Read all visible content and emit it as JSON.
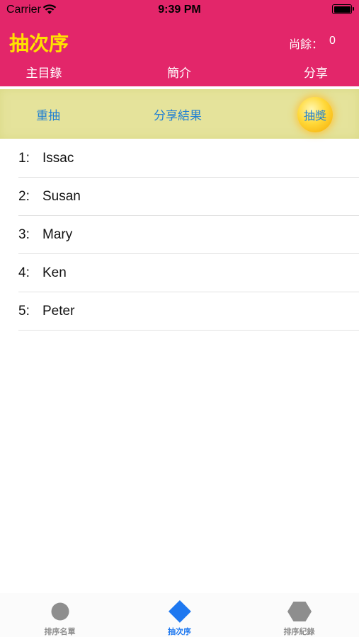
{
  "status_bar": {
    "carrier": "Carrier",
    "time": "9:39 PM"
  },
  "header": {
    "title": "抽次序",
    "remaining_label": "尚餘：",
    "remaining_value": "0",
    "nav": {
      "main_menu": "主目錄",
      "intro": "簡介",
      "share": "分享"
    }
  },
  "actions": {
    "redraw": "重抽",
    "share_result": "分享結果",
    "lottery": "抽獎"
  },
  "list": [
    {
      "num": "1:",
      "name": "Issac"
    },
    {
      "num": "2:",
      "name": "Susan"
    },
    {
      "num": "3:",
      "name": "Mary"
    },
    {
      "num": "4:",
      "name": "Ken"
    },
    {
      "num": "5:",
      "name": "Peter"
    }
  ],
  "tabs": [
    {
      "label": "排序名單",
      "icon": "circle-icon",
      "active": false
    },
    {
      "label": "抽次序",
      "icon": "diamond-icon",
      "active": true
    },
    {
      "label": "排序紀錄",
      "icon": "hexagon-icon",
      "active": false
    }
  ],
  "colors": {
    "header_bg": "#e3266a",
    "title": "#ffe100",
    "action_bar_bg": "#e5e39b",
    "link": "#1f7fd4",
    "tab_active": "#1e78f0",
    "tab_inactive": "#8e8e8e"
  }
}
